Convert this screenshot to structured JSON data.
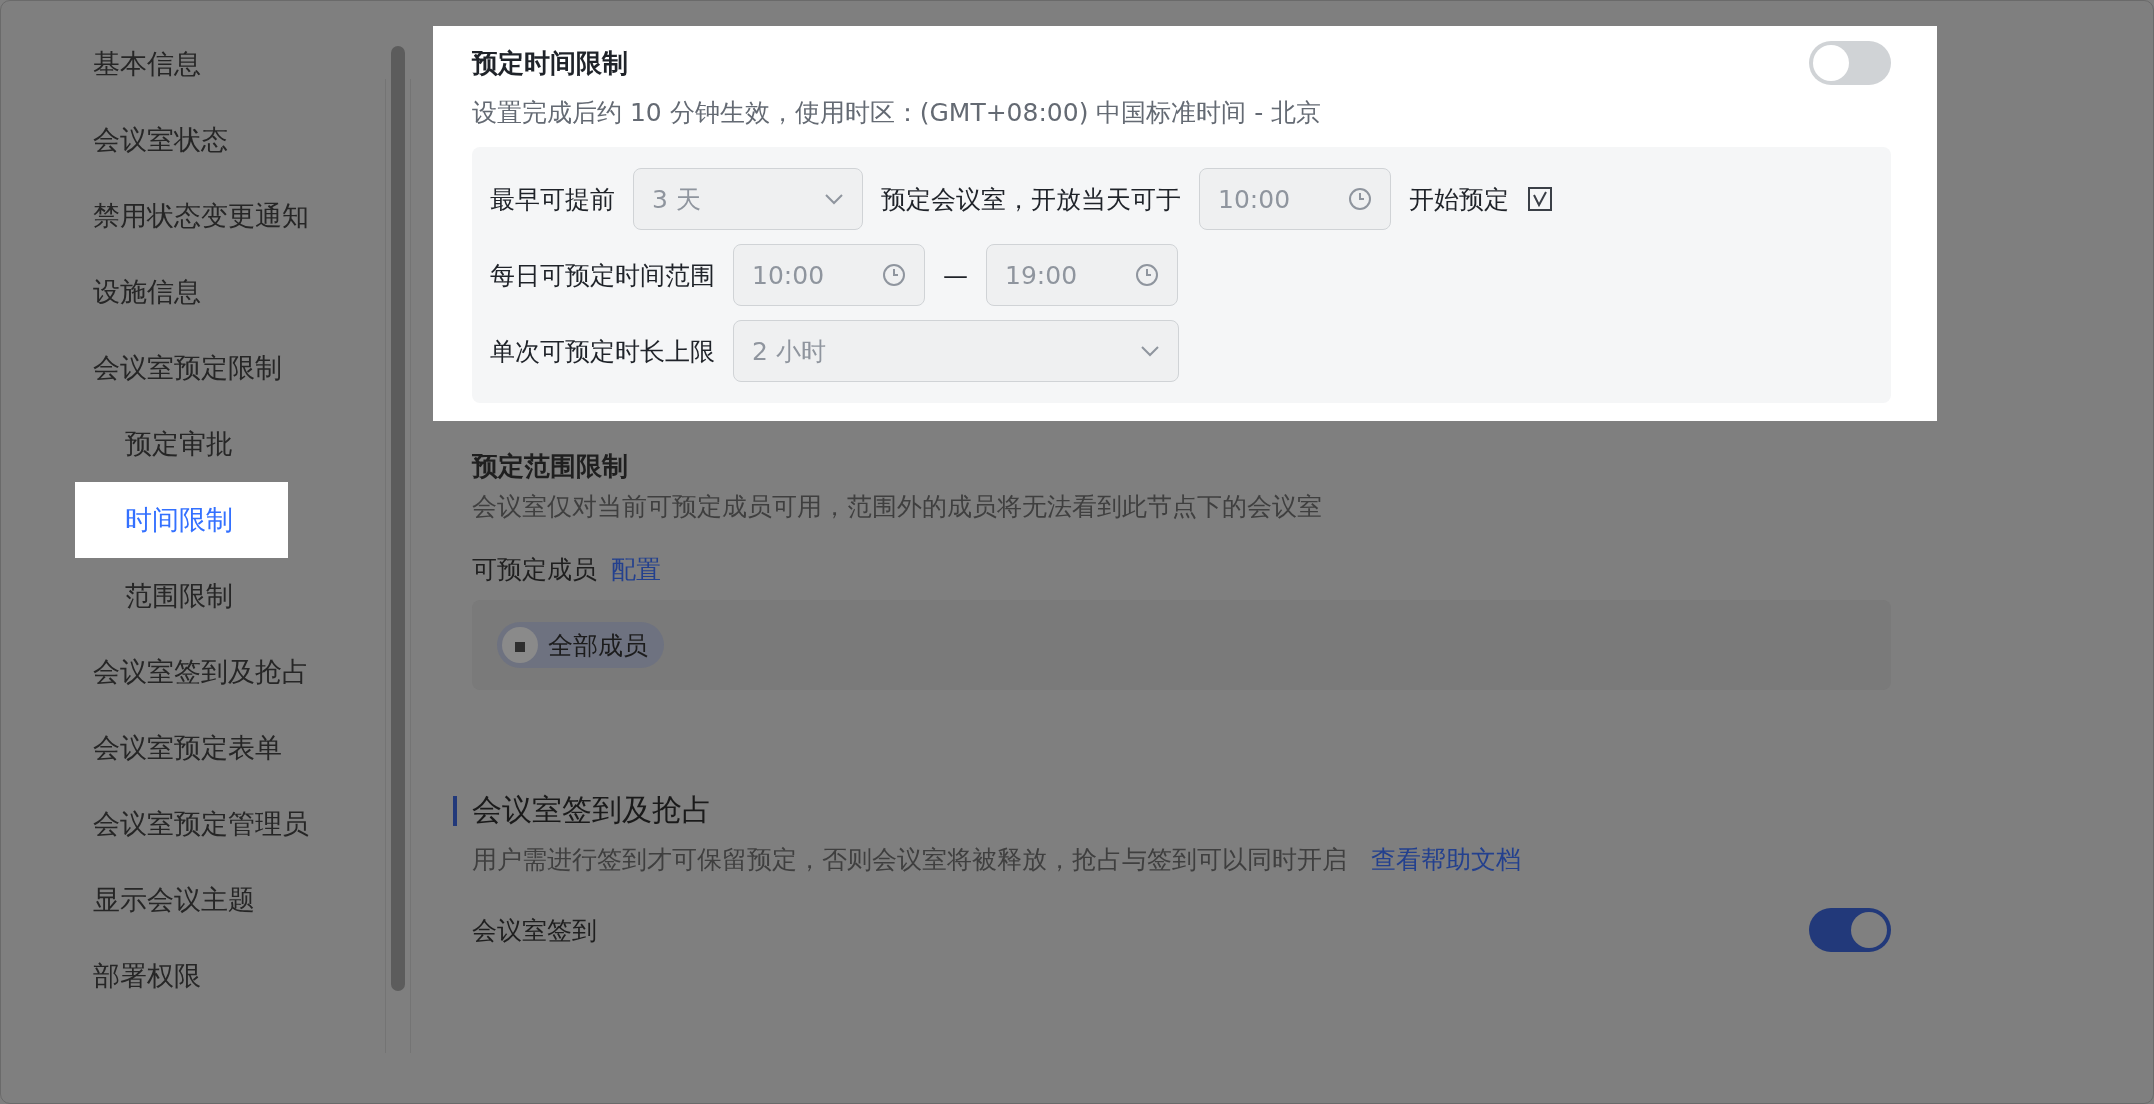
{
  "sidebar": {
    "items": [
      {
        "label": "基本信息",
        "selected": false
      },
      {
        "label": "会议室状态",
        "selected": false
      },
      {
        "label": "禁用状态变更通知",
        "selected": false
      },
      {
        "label": "设施信息",
        "selected": false
      },
      {
        "label": "会议室预定限制",
        "selected": false,
        "children": [
          {
            "label": "预定审批",
            "selected": false
          },
          {
            "label": "时间限制",
            "selected": true
          },
          {
            "label": "范围限制",
            "selected": false
          }
        ]
      },
      {
        "label": "会议室签到及抢占",
        "selected": false
      },
      {
        "label": "会议室预定表单",
        "selected": false
      },
      {
        "label": "会议室预定管理员",
        "selected": false
      },
      {
        "label": "显示会议主题",
        "selected": false
      },
      {
        "label": "部署权限",
        "selected": false
      }
    ]
  },
  "time_limit": {
    "title": "预定时间限制",
    "enabled": false,
    "description": "设置完成后约 10 分钟生效，使用时区：(GMT+08:00) 中国标准时间 - 北京",
    "advance_label": "最早可提前",
    "advance_value": "3 天",
    "open_label": "预定会议室，开放当天可于",
    "open_time": "10:00",
    "start_label": "开始预定",
    "daily_label": "每日可预定时间范围",
    "daily_start": "10:00",
    "range_separator": "—",
    "daily_end": "19:00",
    "max_label": "单次可预定时长上限",
    "max_value": "2 小时"
  },
  "scope_limit": {
    "title": "预定范围限制",
    "description": "会议室仅对当前可预定成员可用，范围外的成员将无法看到此节点下的会议室",
    "members_label": "可预定成员",
    "configure_link": "配置",
    "members": [
      {
        "label": "全部成员"
      }
    ]
  },
  "check_in": {
    "title": "会议室签到及抢占",
    "description": "用户需进行签到才可保留预定，否则会议室将被释放，抢占与签到可以同时开启",
    "help_link": "查看帮助文档",
    "items": [
      {
        "label": "会议室签到",
        "on": true
      }
    ]
  }
}
